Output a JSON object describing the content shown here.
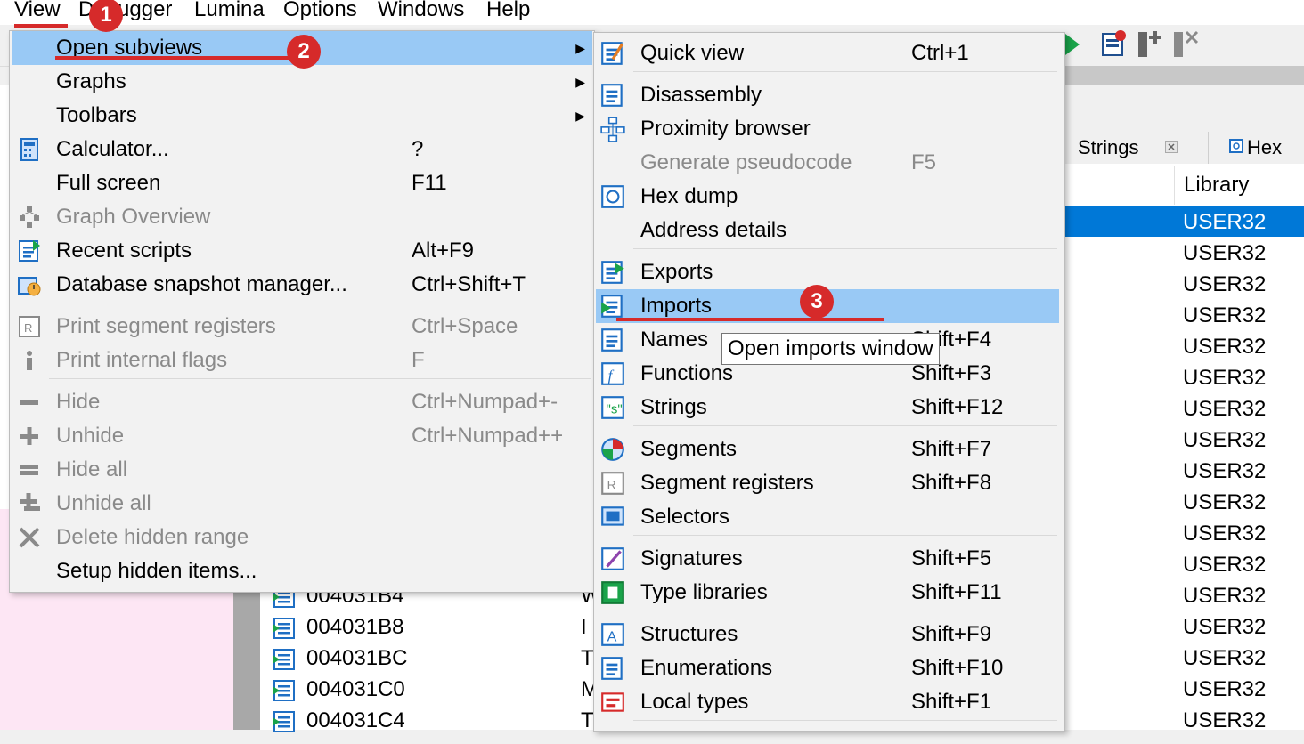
{
  "menubar": {
    "items": [
      "View",
      "Debugger",
      "Lumina",
      "Options",
      "Windows",
      "Help"
    ]
  },
  "tabs": {
    "strings": "Strings",
    "hex_view": "Hex Vie"
  },
  "library_column": {
    "header": "Library",
    "values": [
      "USER32",
      "USER32",
      "USER32",
      "USER32",
      "USER32",
      "USER32",
      "USER32",
      "USER32",
      "USER32",
      "USER32",
      "USER32",
      "USER32",
      "USER32",
      "USER32",
      "USER32",
      "USER32",
      "USER32"
    ]
  },
  "address_list": {
    "rows": [
      {
        "addr": "004031B4",
        "tail": "W"
      },
      {
        "addr": "004031B8",
        "tail": "I"
      },
      {
        "addr": "004031BC",
        "tail": "T"
      },
      {
        "addr": "004031C0",
        "tail": "M"
      },
      {
        "addr": "004031C4",
        "tail": "T"
      }
    ]
  },
  "view_menu": {
    "items": [
      {
        "label": "Open subviews",
        "shortcut": "",
        "submenu": true,
        "icon": "",
        "highlighted": true
      },
      {
        "label": "Graphs",
        "shortcut": "",
        "submenu": true,
        "icon": ""
      },
      {
        "label": "Toolbars",
        "shortcut": "",
        "submenu": true,
        "icon": ""
      },
      {
        "label": "Calculator...",
        "shortcut": "?",
        "icon": "calculator-icon"
      },
      {
        "label": "Full screen",
        "shortcut": "F11",
        "icon": ""
      },
      {
        "label": "Graph Overview",
        "shortcut": "",
        "icon": "graph-overview-icon",
        "disabled": true
      },
      {
        "label": "Recent scripts",
        "shortcut": "Alt+F9",
        "icon": "recent-scripts-icon"
      },
      {
        "label": "Database snapshot manager...",
        "shortcut": "Ctrl+Shift+T",
        "icon": "snapshot-icon"
      },
      {
        "label": "Print segment registers",
        "shortcut": "Ctrl+Space",
        "icon": "segment-registers-icon",
        "disabled": true
      },
      {
        "label": "Print internal flags",
        "shortcut": "F",
        "icon": "info-icon",
        "disabled": true
      },
      {
        "label": "Hide",
        "shortcut": "Ctrl+Numpad+-",
        "icon": "minus-icon",
        "disabled": true
      },
      {
        "label": "Unhide",
        "shortcut": "Ctrl+Numpad++",
        "icon": "plus-icon",
        "disabled": true
      },
      {
        "label": "Hide all",
        "shortcut": "",
        "icon": "minus-all-icon",
        "disabled": true
      },
      {
        "label": "Unhide all",
        "shortcut": "",
        "icon": "plus-all-icon",
        "disabled": true
      },
      {
        "label": "Delete hidden range",
        "shortcut": "",
        "icon": "delete-icon",
        "disabled": true
      },
      {
        "label": "Setup hidden items...",
        "shortcut": "",
        "icon": ""
      }
    ]
  },
  "subviews_menu": {
    "items": [
      {
        "label": "Quick view",
        "shortcut": "Ctrl+1",
        "icon": "quick-view-icon"
      },
      {
        "label": "Disassembly",
        "shortcut": "",
        "icon": "disassembly-icon"
      },
      {
        "label": "Proximity browser",
        "shortcut": "",
        "icon": "proximity-icon"
      },
      {
        "label": "Generate pseudocode",
        "shortcut": "F5",
        "icon": "",
        "disabled": true
      },
      {
        "label": "Hex dump",
        "shortcut": "",
        "icon": "hex-dump-icon"
      },
      {
        "label": "Address details",
        "shortcut": "",
        "icon": ""
      },
      {
        "label": "Exports",
        "shortcut": "",
        "icon": "exports-icon"
      },
      {
        "label": "Imports",
        "shortcut": "",
        "icon": "imports-icon",
        "highlighted": true
      },
      {
        "label": "Names",
        "shortcut": "Shift+F4",
        "icon": "names-icon"
      },
      {
        "label": "Functions",
        "shortcut": "Shift+F3",
        "icon": "functions-icon"
      },
      {
        "label": "Strings",
        "shortcut": "Shift+F12",
        "icon": "strings-icon"
      },
      {
        "label": "Segments",
        "shortcut": "Shift+F7",
        "icon": "segments-icon"
      },
      {
        "label": "Segment registers",
        "shortcut": "Shift+F8",
        "icon": "segment-registers-icon"
      },
      {
        "label": "Selectors",
        "shortcut": "",
        "icon": "selectors-icon"
      },
      {
        "label": "Signatures",
        "shortcut": "Shift+F5",
        "icon": "signatures-icon"
      },
      {
        "label": "Type libraries",
        "shortcut": "Shift+F11",
        "icon": "type-libraries-icon"
      },
      {
        "label": "Structures",
        "shortcut": "Shift+F9",
        "icon": "structures-icon"
      },
      {
        "label": "Enumerations",
        "shortcut": "Shift+F10",
        "icon": "enumerations-icon"
      },
      {
        "label": "Local types",
        "shortcut": "Shift+F1",
        "icon": "local-types-icon"
      }
    ]
  },
  "tooltip": {
    "text": "Open imports window"
  },
  "annotations": {
    "step1": "1",
    "step2": "2",
    "step3": "3"
  },
  "colors": {
    "highlight": "#99c9f5",
    "selection": "#0078d7",
    "annotation_red": "#d62a2a",
    "pink_panel": "#fde6f4"
  }
}
